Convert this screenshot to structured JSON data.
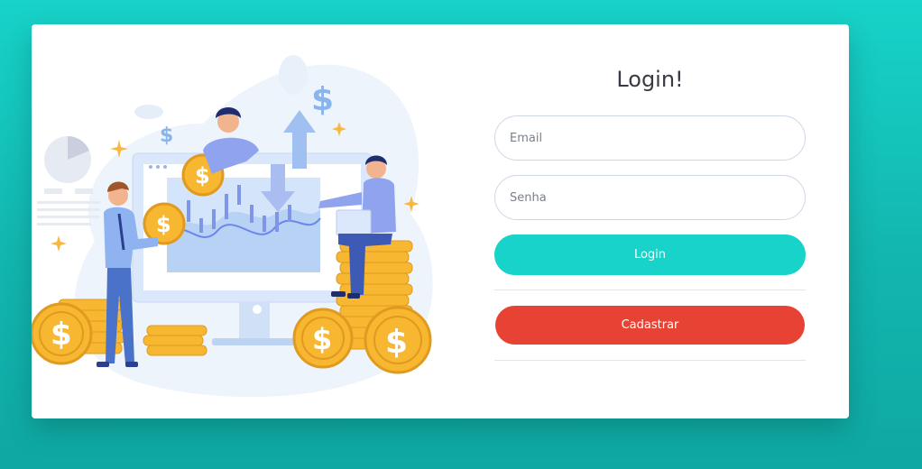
{
  "login_form": {
    "title": "Login!",
    "email_placeholder": "Email",
    "password_placeholder": "Senha",
    "login_button_label": "Login",
    "register_button_label": "Cadastrar"
  },
  "illustration": {
    "subject": "finance-team-illustration",
    "dollar_sign": "$"
  },
  "colors": {
    "background": "#17d3c9",
    "login_button": "#17d3c9",
    "register_button": "#e84234",
    "coin": "#f7b731",
    "accent_blue": "#6d86ea"
  }
}
